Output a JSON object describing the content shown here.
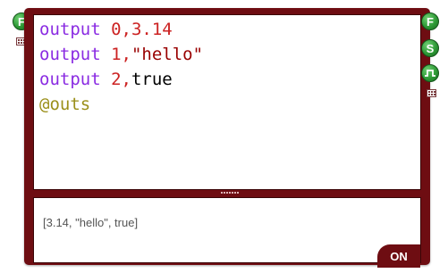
{
  "code": {
    "line1": {
      "keyword": "output",
      "rest_num": " 0,3.14"
    },
    "line2": {
      "keyword": "output",
      "index": " 1,",
      "string": "\"hello\""
    },
    "line3": {
      "keyword": "output",
      "index": " 2,",
      "value": "true"
    },
    "line4": {
      "ref": "@outs"
    }
  },
  "output": {
    "text": "[3.14, \"hello\", true]",
    "toggle_label": "ON"
  },
  "ports": {
    "left_f": "F",
    "right_f": "F",
    "right_s": "S",
    "right_pulse": "⎍"
  },
  "colors": {
    "frame": "#6e0d12",
    "keyword": "#8a2be2",
    "number": "#cc2222",
    "string": "#990000",
    "reference": "#9b8f1a",
    "port_green": "#2e9a36"
  }
}
